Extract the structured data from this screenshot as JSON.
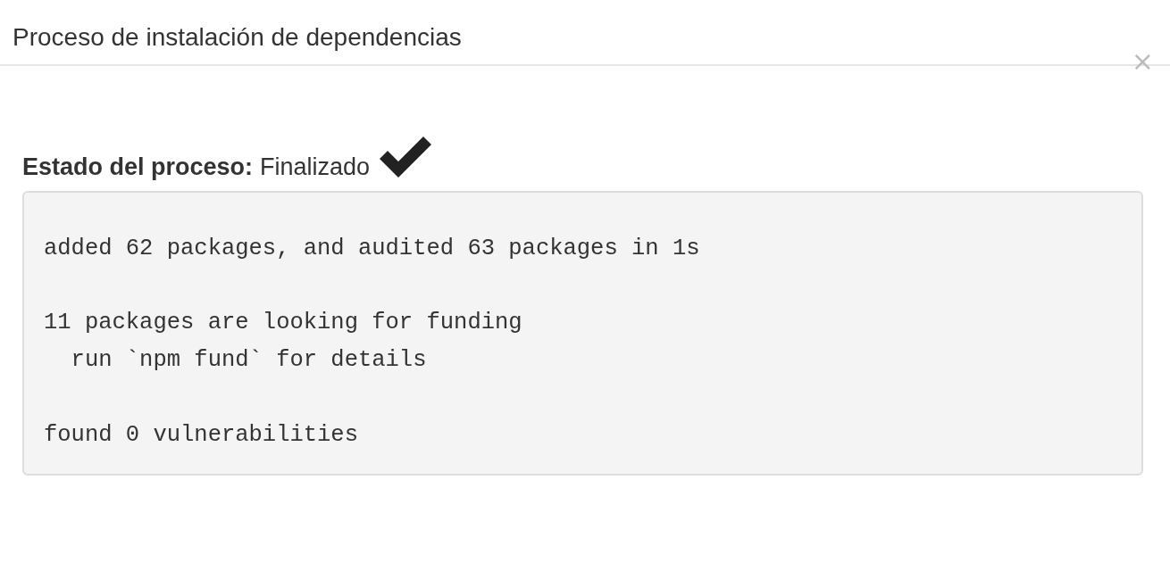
{
  "dialog": {
    "title": "Proceso de instalación de dependencias",
    "close": "×"
  },
  "status": {
    "label": "Estado del proceso:",
    "value": "Finalizado",
    "completed": true
  },
  "output": {
    "text": "\nadded 62 packages, and audited 63 packages in 1s\n\n11 packages are looking for funding\n  run `npm fund` for details\n\nfound 0 vulnerabilities"
  }
}
